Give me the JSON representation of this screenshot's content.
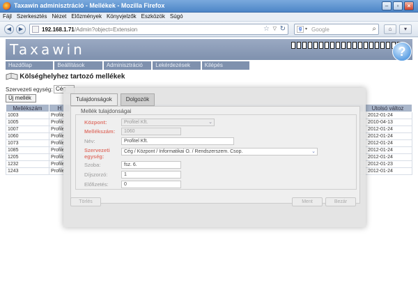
{
  "window": {
    "title": "Taxawin adminisztráció - Mellékek - Mozilla Firefox"
  },
  "menu": [
    "Fájl",
    "Szerkesztés",
    "Nézet",
    "Előzmények",
    "Könyvjelzők",
    "Eszközök",
    "Súgó"
  ],
  "address": {
    "host": "192.168.1.71",
    "path": "/Admin?object=Extension"
  },
  "search": {
    "engine": "g",
    "placeholder": "Google"
  },
  "app": {
    "logo": "Taxawin",
    "help": "?",
    "tabs": [
      "Hazdőlap",
      "Beállítások",
      "Adminisztráció",
      "Lekérdezések",
      "Kilépés"
    ],
    "page_title": "Kölséghelyhez tartozó mellékek",
    "org_label": "Szervezeti egység:",
    "org_value": "Cég",
    "new_button": "Új mellék",
    "table": {
      "headers": {
        "extension": "Mellékszám",
        "col2": "H",
        "last_change": "Utolsó változ"
      },
      "rows": [
        {
          "ext": "1003",
          "c2": "Profile",
          "date": "2012-01-24"
        },
        {
          "ext": "1005",
          "c2": "Profile",
          "date": "2010-04-13"
        },
        {
          "ext": "1007",
          "c2": "Profile",
          "date": "2012-01-24"
        },
        {
          "ext": "1060",
          "c2": "Profile",
          "date": "2012-01-24"
        },
        {
          "ext": "1073",
          "c2": "Profile",
          "date": "2012-01-24"
        },
        {
          "ext": "1085",
          "c2": "Profile",
          "date": "2012-01-24"
        },
        {
          "ext": "1205",
          "c2": "Profile",
          "date": "2012-01-24"
        },
        {
          "ext": "1232",
          "c2": "Profile",
          "date": "2012-01-23"
        },
        {
          "ext": "1243",
          "c2": "Profile",
          "date": "2012-01-24"
        }
      ]
    }
  },
  "modal": {
    "tab_properties": "Tulajdonságok",
    "tab_workers": "Dolgozók",
    "legend": "Mellék tulajdonságai",
    "fields": {
      "center_label": "Központ:",
      "center_value": "Profitel Kft.",
      "ext_label": "Mellékszám:",
      "ext_value": "1060",
      "name_label": "Név:",
      "name_value": "Profitel Kft.",
      "org_label_1": "Szervezeti",
      "org_label_2": "egység:",
      "org_value": "Cég / Központ / Informatikai O. / Rendszerszem. Csop.",
      "room_label": "Szoba:",
      "room_value": "fsz. 6.",
      "multiplier_label": "Díjszorzó:",
      "multiplier_value": "1",
      "prepay_label": "Előfizetés:",
      "prepay_value": "0"
    },
    "buttons": {
      "delete": "Törlés",
      "save": "Ment",
      "close": "Bezár"
    }
  }
}
